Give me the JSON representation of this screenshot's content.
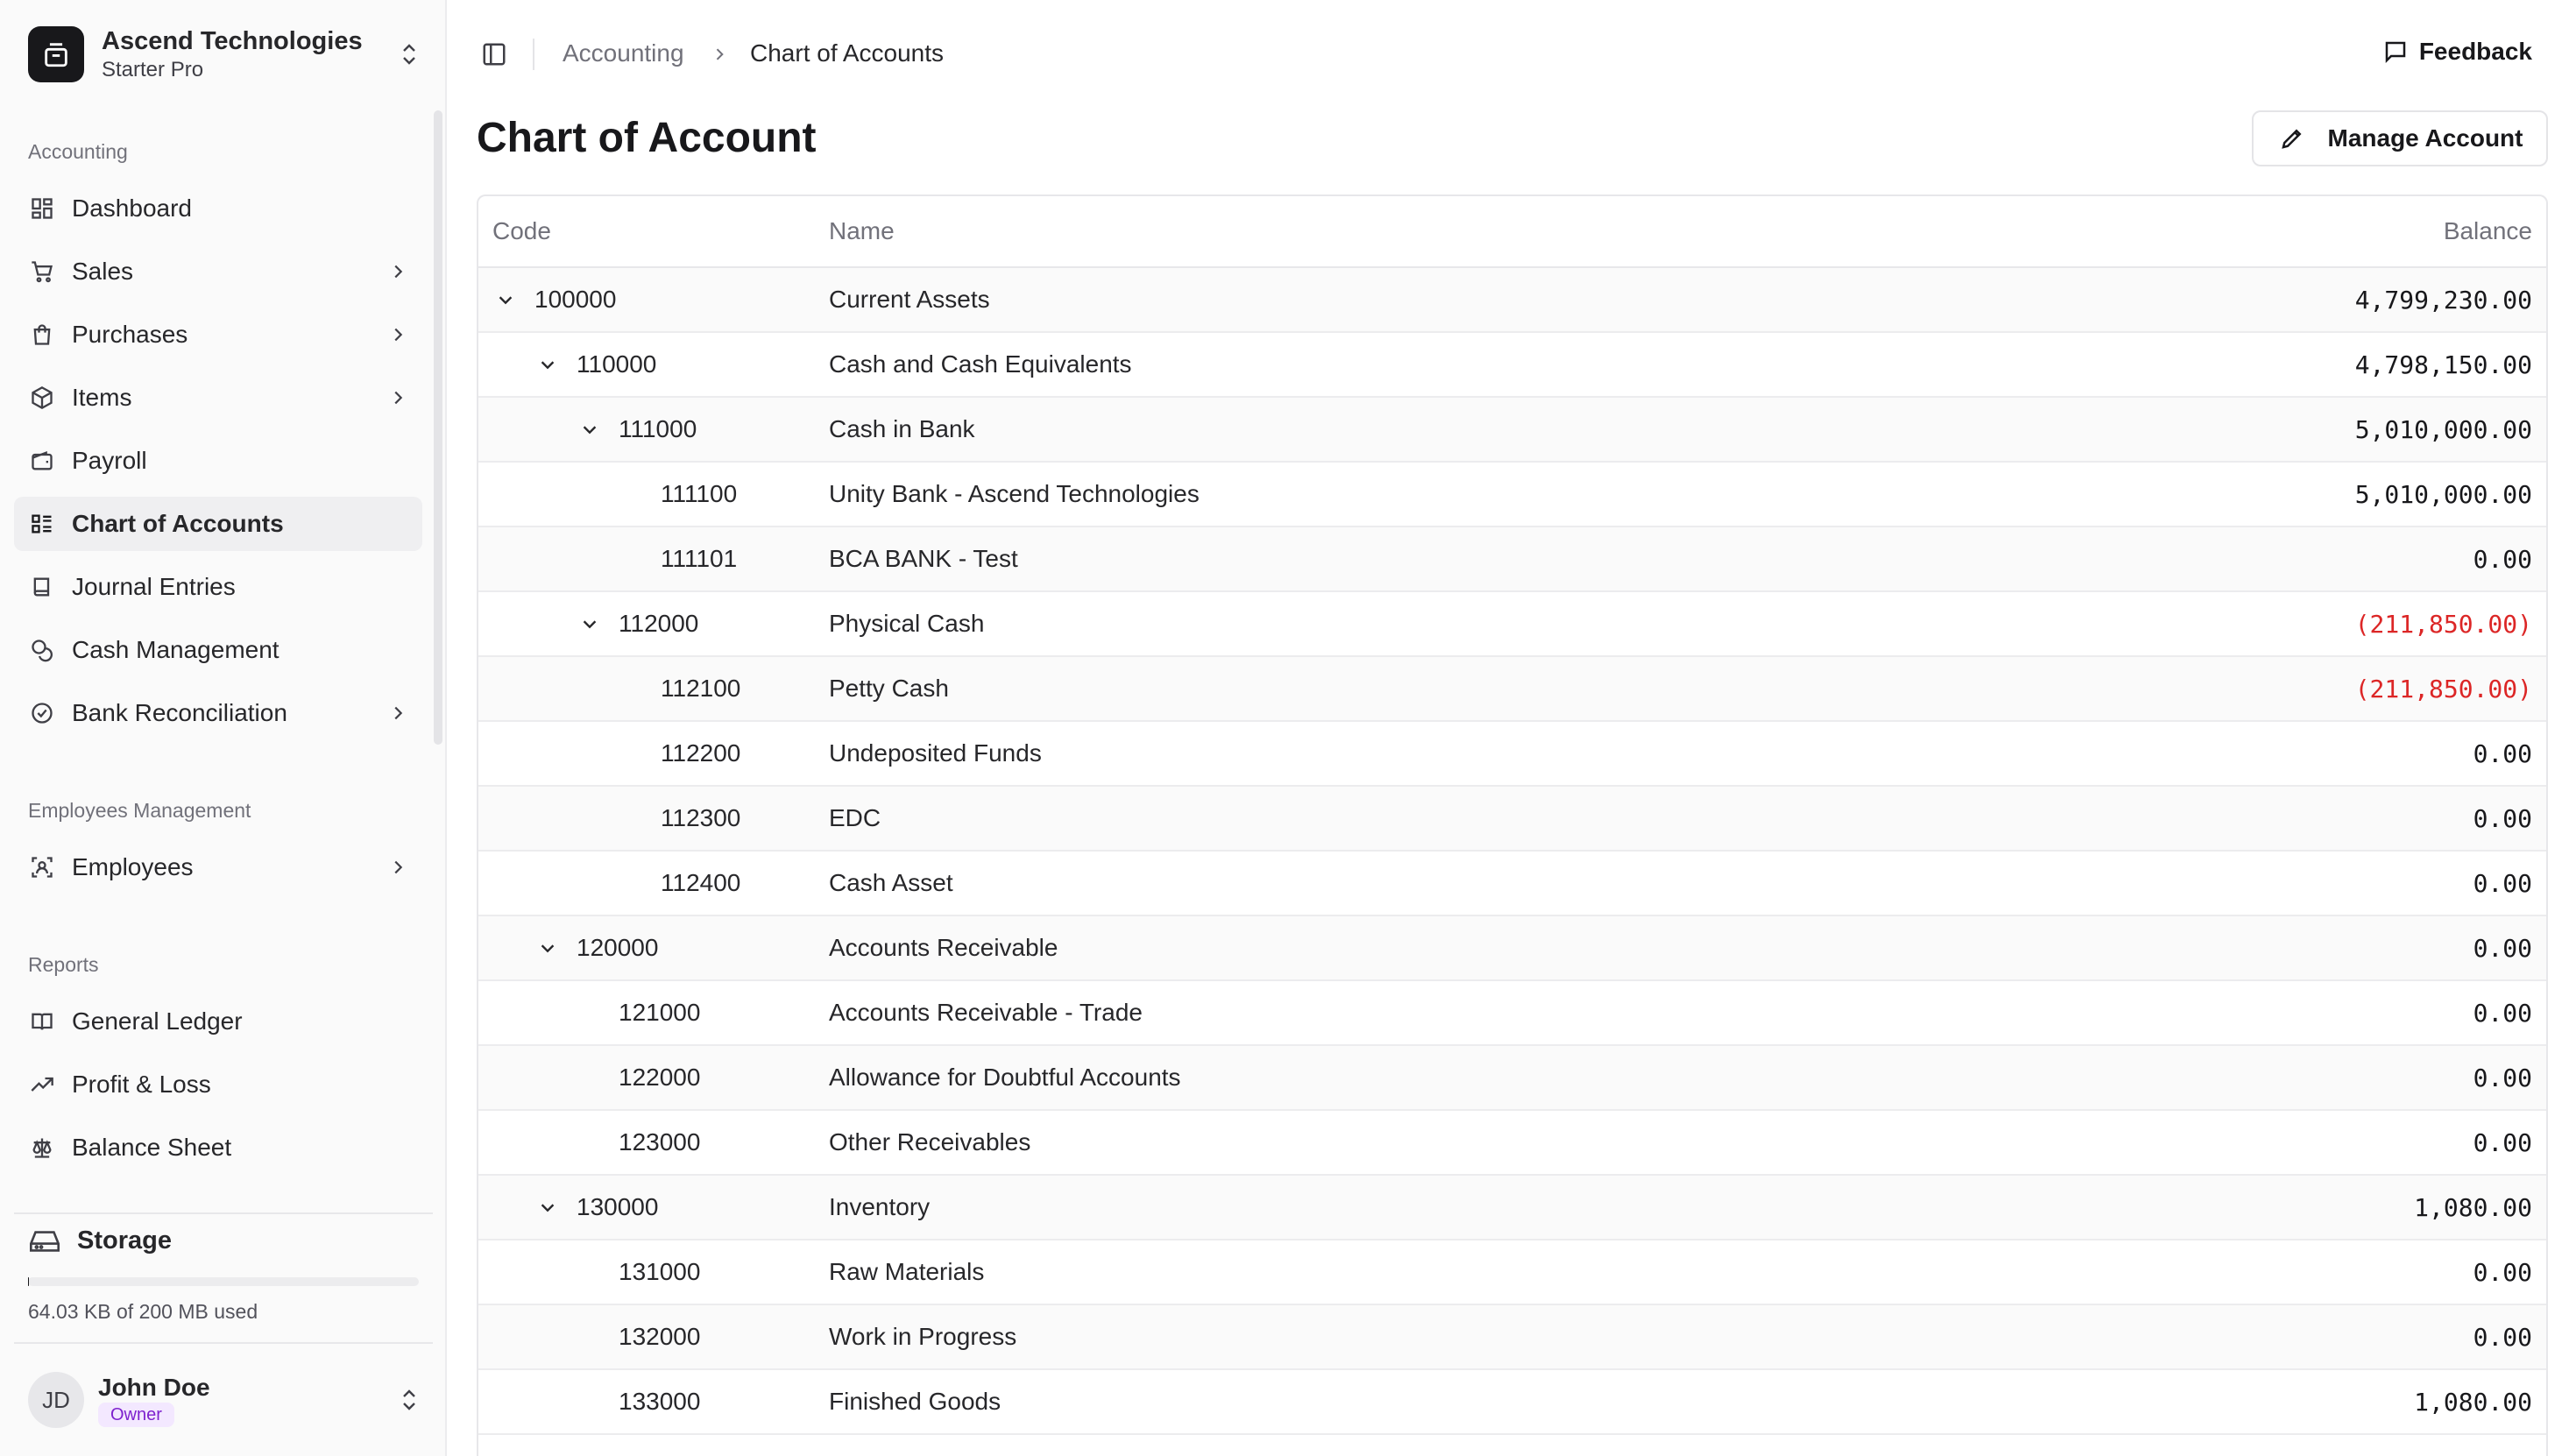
{
  "org": {
    "name": "Ascend Technologies",
    "plan": "Starter Pro"
  },
  "sidebar": {
    "groups": [
      {
        "label": "Accounting"
      },
      {
        "label": "Employees Management"
      },
      {
        "label": "Reports"
      }
    ],
    "items": [
      {
        "label": "Dashboard",
        "icon": "dashboard-icon"
      },
      {
        "label": "Sales",
        "icon": "cart-icon"
      },
      {
        "label": "Purchases",
        "icon": "shopping-bag-icon"
      },
      {
        "label": "Items",
        "icon": "package-icon"
      },
      {
        "label": "Payroll",
        "icon": "wallet-icon"
      },
      {
        "label": "Chart of Accounts",
        "icon": "chart-list-icon"
      },
      {
        "label": "Journal Entries",
        "icon": "book-icon"
      },
      {
        "label": "Cash Management",
        "icon": "coins-icon"
      },
      {
        "label": "Bank Reconciliation",
        "icon": "check-circle-icon"
      },
      {
        "label": "Employees",
        "icon": "employees-icon"
      },
      {
        "label": "General Ledger",
        "icon": "ledger-icon"
      },
      {
        "label": "Profit & Loss",
        "icon": "trending-up-icon"
      },
      {
        "label": "Balance Sheet",
        "icon": "scale-icon"
      }
    ],
    "active_item": "Chart of Accounts"
  },
  "storage": {
    "label": "Storage",
    "usage_text": "64.03 KB of 200 MB used",
    "used_fraction": 0.0003
  },
  "user": {
    "name": "John Doe",
    "initials": "JD",
    "role": "Owner"
  },
  "breadcrumb": {
    "parent": "Accounting",
    "current": "Chart of Accounts"
  },
  "header": {
    "feedback_label": "Feedback"
  },
  "page": {
    "title": "Chart of Account",
    "manage_label": "Manage Account"
  },
  "table": {
    "columns": {
      "code": "Code",
      "name": "Name",
      "balance": "Balance"
    },
    "rows": [
      {
        "code": "100000",
        "name": "Current Assets",
        "balance": "4,799,230.00",
        "level": 0,
        "expandable": true,
        "negative": false
      },
      {
        "code": "110000",
        "name": "Cash and Cash Equivalents",
        "balance": "4,798,150.00",
        "level": 1,
        "expandable": true,
        "negative": false
      },
      {
        "code": "111000",
        "name": "Cash in Bank",
        "balance": "5,010,000.00",
        "level": 2,
        "expandable": true,
        "negative": false
      },
      {
        "code": "111100",
        "name": "Unity Bank - Ascend Technologies",
        "balance": "5,010,000.00",
        "level": 3,
        "expandable": false,
        "negative": false
      },
      {
        "code": "111101",
        "name": "BCA BANK - Test",
        "balance": "0.00",
        "level": 3,
        "expandable": false,
        "negative": false
      },
      {
        "code": "112000",
        "name": "Physical Cash",
        "balance": "(211,850.00)",
        "level": 2,
        "expandable": true,
        "negative": true
      },
      {
        "code": "112100",
        "name": "Petty Cash",
        "balance": "(211,850.00)",
        "level": 3,
        "expandable": false,
        "negative": true
      },
      {
        "code": "112200",
        "name": "Undeposited Funds",
        "balance": "0.00",
        "level": 3,
        "expandable": false,
        "negative": false
      },
      {
        "code": "112300",
        "name": "EDC",
        "balance": "0.00",
        "level": 3,
        "expandable": false,
        "negative": false
      },
      {
        "code": "112400",
        "name": "Cash Asset",
        "balance": "0.00",
        "level": 3,
        "expandable": false,
        "negative": false
      },
      {
        "code": "120000",
        "name": "Accounts Receivable",
        "balance": "0.00",
        "level": 1,
        "expandable": true,
        "negative": false
      },
      {
        "code": "121000",
        "name": "Accounts Receivable - Trade",
        "balance": "0.00",
        "level": 2,
        "expandable": false,
        "negative": false
      },
      {
        "code": "122000",
        "name": "Allowance for Doubtful Accounts",
        "balance": "0.00",
        "level": 2,
        "expandable": false,
        "negative": false
      },
      {
        "code": "123000",
        "name": "Other Receivables",
        "balance": "0.00",
        "level": 2,
        "expandable": false,
        "negative": false
      },
      {
        "code": "130000",
        "name": "Inventory",
        "balance": "1,080.00",
        "level": 1,
        "expandable": true,
        "negative": false
      },
      {
        "code": "131000",
        "name": "Raw Materials",
        "balance": "0.00",
        "level": 2,
        "expandable": false,
        "negative": false
      },
      {
        "code": "132000",
        "name": "Work in Progress",
        "balance": "0.00",
        "level": 2,
        "expandable": false,
        "negative": false
      },
      {
        "code": "133000",
        "name": "Finished Goods",
        "balance": "1,080.00",
        "level": 2,
        "expandable": false,
        "negative": false
      }
    ]
  },
  "colors": {
    "negative": "#dc2626",
    "active_bg": "#efeff1",
    "role_badge": "#7e22ce"
  }
}
